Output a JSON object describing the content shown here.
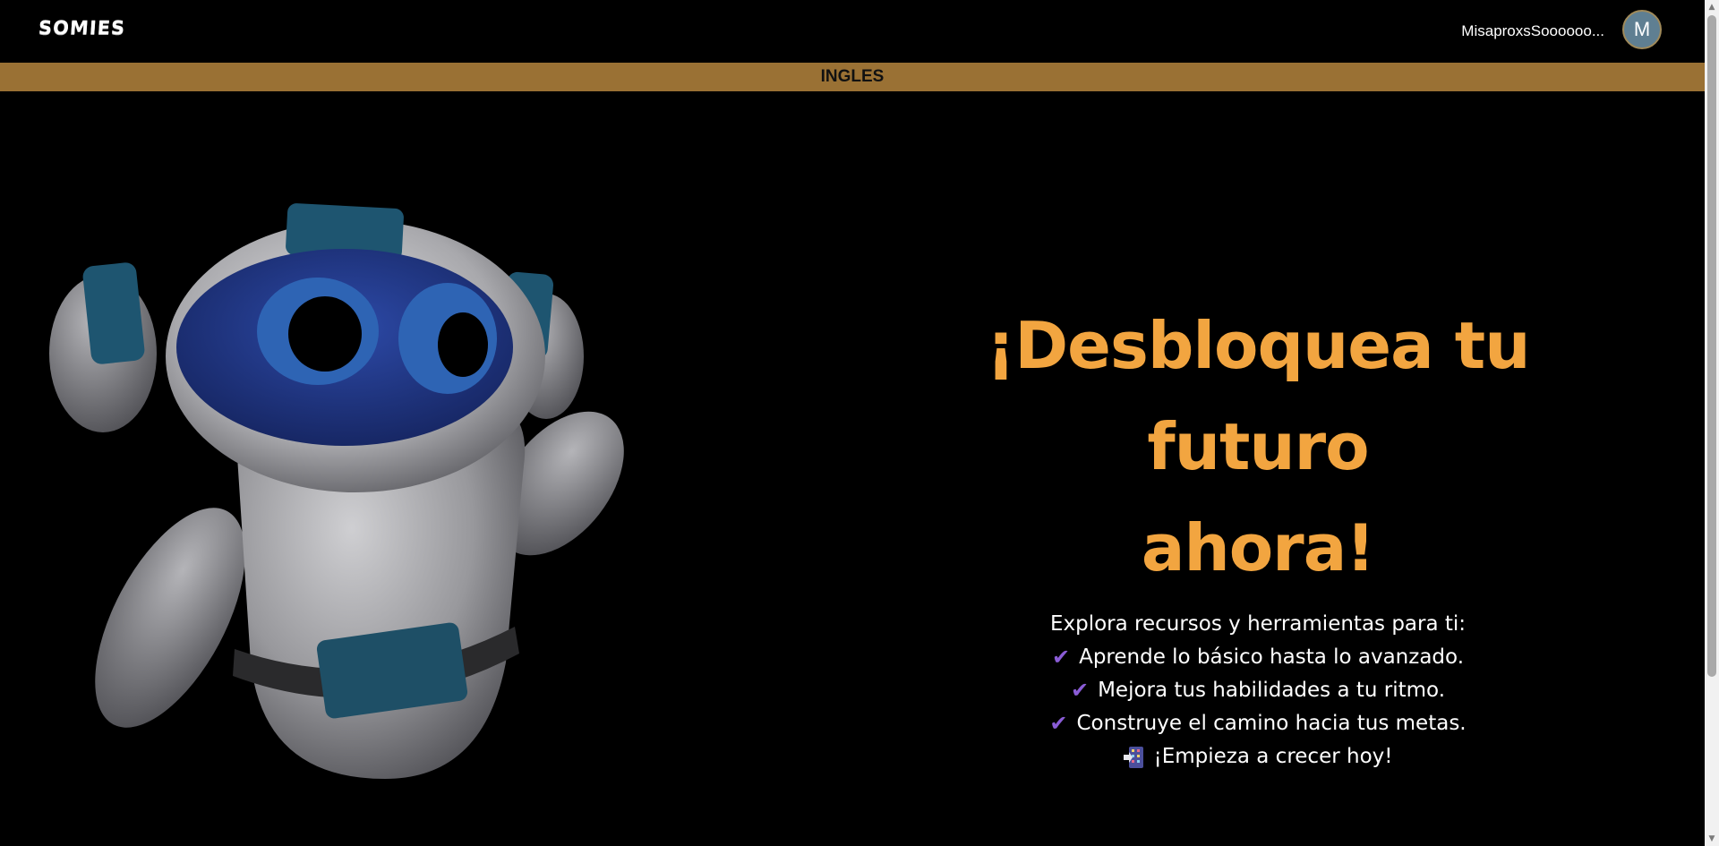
{
  "header": {
    "logo": "SOMIES",
    "user_name": "MisaproxsSoooooo...",
    "avatar_initial": "M"
  },
  "banner": {
    "label": "INGLES"
  },
  "hero": {
    "title_line1": "¡Desbloquea tu futuro",
    "title_line2": "ahora!",
    "intro": "Explora recursos y herramientas para ti:",
    "features": [
      "Aprende lo básico hasta lo avanzado.",
      "Mejora tus habilidades a tu ritmo.",
      "Construye el camino hacia tus metas."
    ],
    "cta": "¡Empieza a crecer hoy!",
    "feature_icon": "check-icon",
    "cta_icon": "building-icon"
  },
  "colors": {
    "banner": "#9a7134",
    "title": "#f2a540",
    "check": "#8a5cd6",
    "background": "#000000"
  }
}
